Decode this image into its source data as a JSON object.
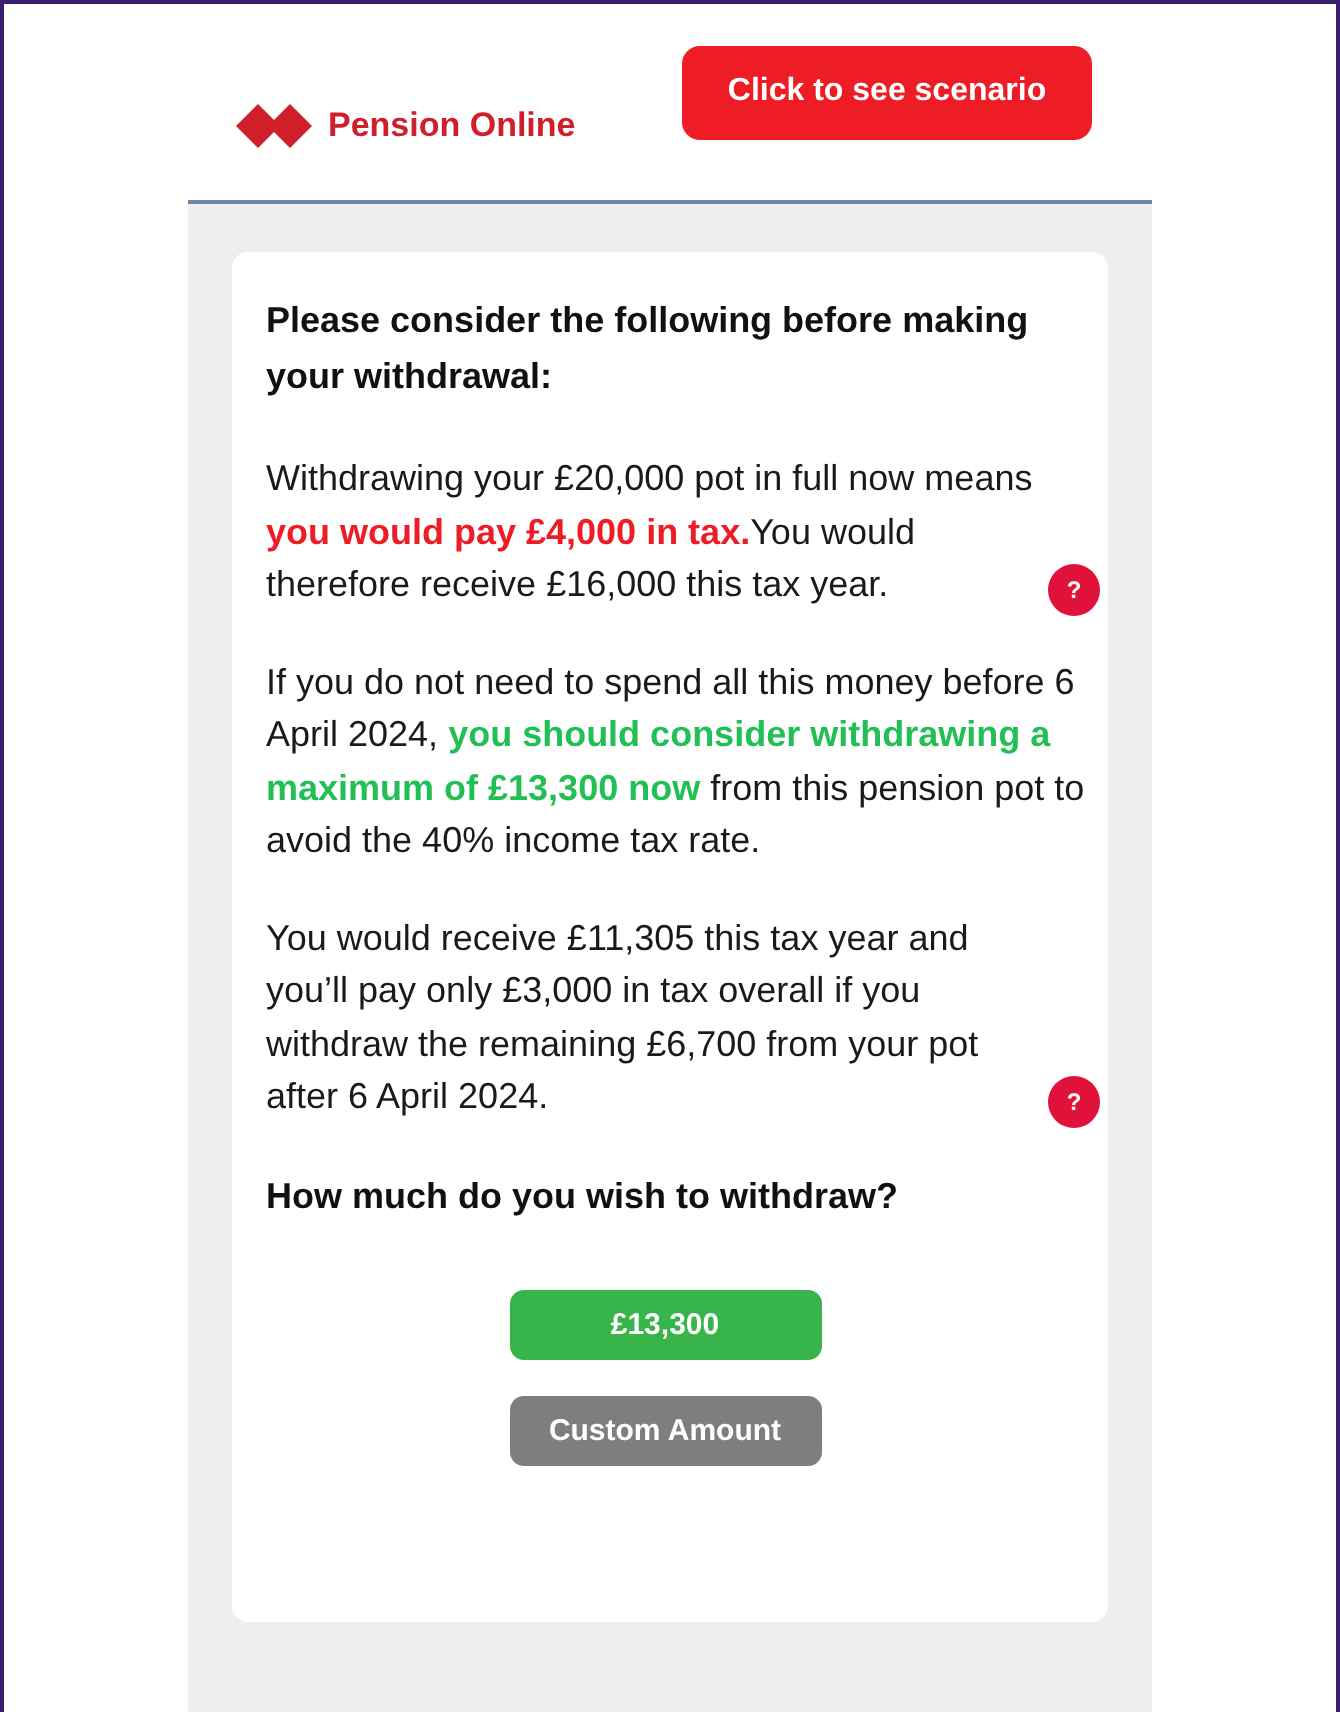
{
  "header": {
    "brand": "Pension Online",
    "scenario_button": "Click to see scenario"
  },
  "card": {
    "heading": "Please consider the following before making your withdrawal:",
    "paragraphs": [
      {
        "help": true,
        "help_label": "?",
        "segments": [
          {
            "kind": "plain",
            "text": "Withdrawing your £20,000 pot in full now means "
          },
          {
            "kind": "red",
            "text": "you would pay £4,000 in tax."
          },
          {
            "kind": "plain",
            "text": "You would therefore receive £16,000 this tax year."
          }
        ]
      },
      {
        "help": false,
        "segments": [
          {
            "kind": "plain",
            "text": "If you do not need to spend all this money before 6 April 2024, "
          },
          {
            "kind": "green",
            "text": "you should consider withdrawing a maximum of £13,300 now"
          },
          {
            "kind": "plain",
            "text": " from this pension pot to avoid the 40% income tax rate."
          }
        ]
      },
      {
        "help": true,
        "help_label": "?",
        "segments": [
          {
            "kind": "plain",
            "text": "You would receive £11,305 this tax year and you’ll pay only £3,000 in tax overall if you withdraw the remaining £6,700 from your pot after 6 April 2024."
          }
        ]
      }
    ],
    "question": "How much do you wish to withdraw?",
    "options": [
      {
        "kind": "primary",
        "label": "£13,300"
      },
      {
        "kind": "secondary",
        "label": "Custom Amount"
      }
    ]
  }
}
